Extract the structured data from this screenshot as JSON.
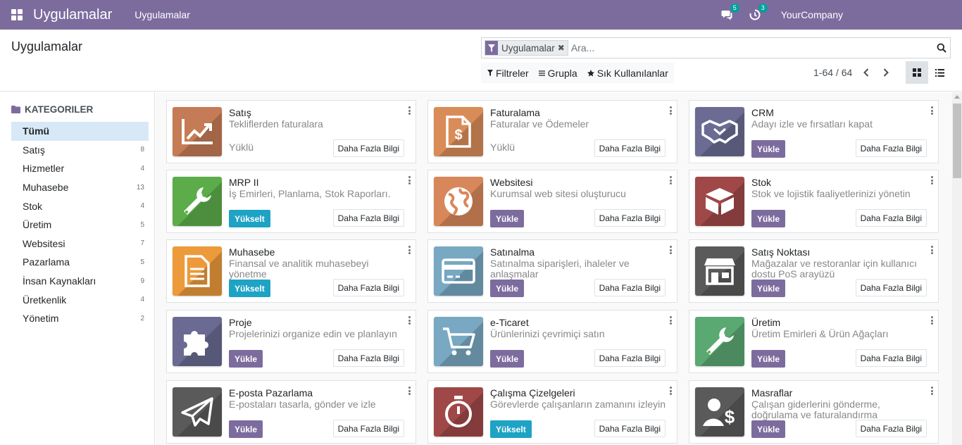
{
  "navbar": {
    "brand": "Uygulamalar",
    "menu": "Uygulamalar",
    "messages_count": "5",
    "activities_count": "3",
    "company": "YourCompany"
  },
  "control_panel": {
    "breadcrumb": "Uygulamalar",
    "search": {
      "facet": "Uygulamalar",
      "placeholder": "Ara..."
    },
    "filters": "Filtreler",
    "group": "Grupla",
    "favorites": "Sık Kullanılanlar",
    "pager": "1-64 / 64"
  },
  "sidebar": {
    "heading": "KATEGORILER",
    "items": [
      {
        "label": "Tümü",
        "count": ""
      },
      {
        "label": "Satış",
        "count": "8"
      },
      {
        "label": "Hizmetler",
        "count": "4"
      },
      {
        "label": "Muhasebe",
        "count": "13"
      },
      {
        "label": "Stok",
        "count": "4"
      },
      {
        "label": "Üretim",
        "count": "5"
      },
      {
        "label": "Websitesi",
        "count": "7"
      },
      {
        "label": "Pazarlama",
        "count": "5"
      },
      {
        "label": "İnsan Kaynakları",
        "count": "9"
      },
      {
        "label": "Üretkenlik",
        "count": "4"
      },
      {
        "label": "Yönetim",
        "count": "2"
      }
    ]
  },
  "apps": [
    {
      "name": "Satış",
      "summary": "Tekliflerden faturalara",
      "status": "Yüklü",
      "action": "",
      "icon": "trend-chart-icon",
      "color": "#c57b55"
    },
    {
      "name": "Faturalama",
      "summary": "Faturalar ve Ödemeler",
      "status": "Yüklü",
      "action": "",
      "icon": "invoice-dollar-icon",
      "color": "#d98c58"
    },
    {
      "name": "CRM",
      "summary": "Adayı izle ve fırsatları kapat",
      "status": "",
      "action": "Yükle",
      "icon": "handshake-icon",
      "color": "#6b6b93"
    },
    {
      "name": "MRP II",
      "summary": "İş Emirleri, Planlama, Stok Raporları.",
      "status": "",
      "action": "Yükselt",
      "icon": "wrench-icon",
      "color": "#5cad4a"
    },
    {
      "name": "Websitesi",
      "summary": "Kurumsal web sitesi oluşturucu",
      "status": "",
      "action": "Yükle",
      "icon": "globe-icon",
      "color": "#d8875a"
    },
    {
      "name": "Stok",
      "summary": "Stok ve lojistik faaliyetlerinizi yönetin",
      "status": "",
      "action": "Yükle",
      "icon": "box-icon",
      "color": "#a04848"
    },
    {
      "name": "Muhasebe",
      "summary": "Finansal ve analitik muhasebeyi yönetme",
      "status": "",
      "action": "Yükselt",
      "icon": "document-icon",
      "color": "#ec9a3a"
    },
    {
      "name": "Satınalma",
      "summary": "Satınalma siparişleri, ihaleler ve anlaşmalar",
      "status": "",
      "action": "Yükle",
      "icon": "credit-card-icon",
      "color": "#78a8c2"
    },
    {
      "name": "Satış Noktası",
      "summary": "Mağazalar ve restoranlar için kullanıcı dostu PoS arayüzü",
      "status": "",
      "action": "Yükle",
      "icon": "store-icon",
      "color": "#5a5a5a"
    },
    {
      "name": "Proje",
      "summary": "Projelerinizi organize edin ve planlayın",
      "status": "",
      "action": "Yükle",
      "icon": "puzzle-icon",
      "color": "#6a6a93"
    },
    {
      "name": "e-Ticaret",
      "summary": "Ürünlerinizi çevrimiçi satın",
      "status": "",
      "action": "Yükle",
      "icon": "shopping-cart-icon",
      "color": "#79a8c2"
    },
    {
      "name": "Üretim",
      "summary": "Üretim Emirleri & Ürün Ağaçları",
      "status": "",
      "action": "Yükle",
      "icon": "wrench-icon",
      "color": "#5aa872"
    },
    {
      "name": "E-posta Pazarlama",
      "summary": "E-postaları tasarla, gönder ve izle",
      "status": "",
      "action": "Yükle",
      "icon": "paper-plane-icon",
      "color": "#5a5a5a"
    },
    {
      "name": "Çalışma Çizelgeleri",
      "summary": "Görevlerde çalışanların zamanını izleyin",
      "status": "",
      "action": "Yükselt",
      "icon": "stopwatch-icon",
      "color": "#a04848"
    },
    {
      "name": "Masraflar",
      "summary": "Çalışan giderlerini gönderme, doğrulama ve faturalandırma",
      "status": "",
      "action": "Yükle",
      "icon": "user-dollar-icon",
      "color": "#5a5a5a"
    }
  ],
  "labels": {
    "learn_more": "Daha Fazla Bilgi"
  },
  "colors": {
    "brand": "#7c6c9e",
    "upgrade": "#1ea3c4",
    "badge": "#00a09d",
    "active_category": "#d7e9f7"
  }
}
